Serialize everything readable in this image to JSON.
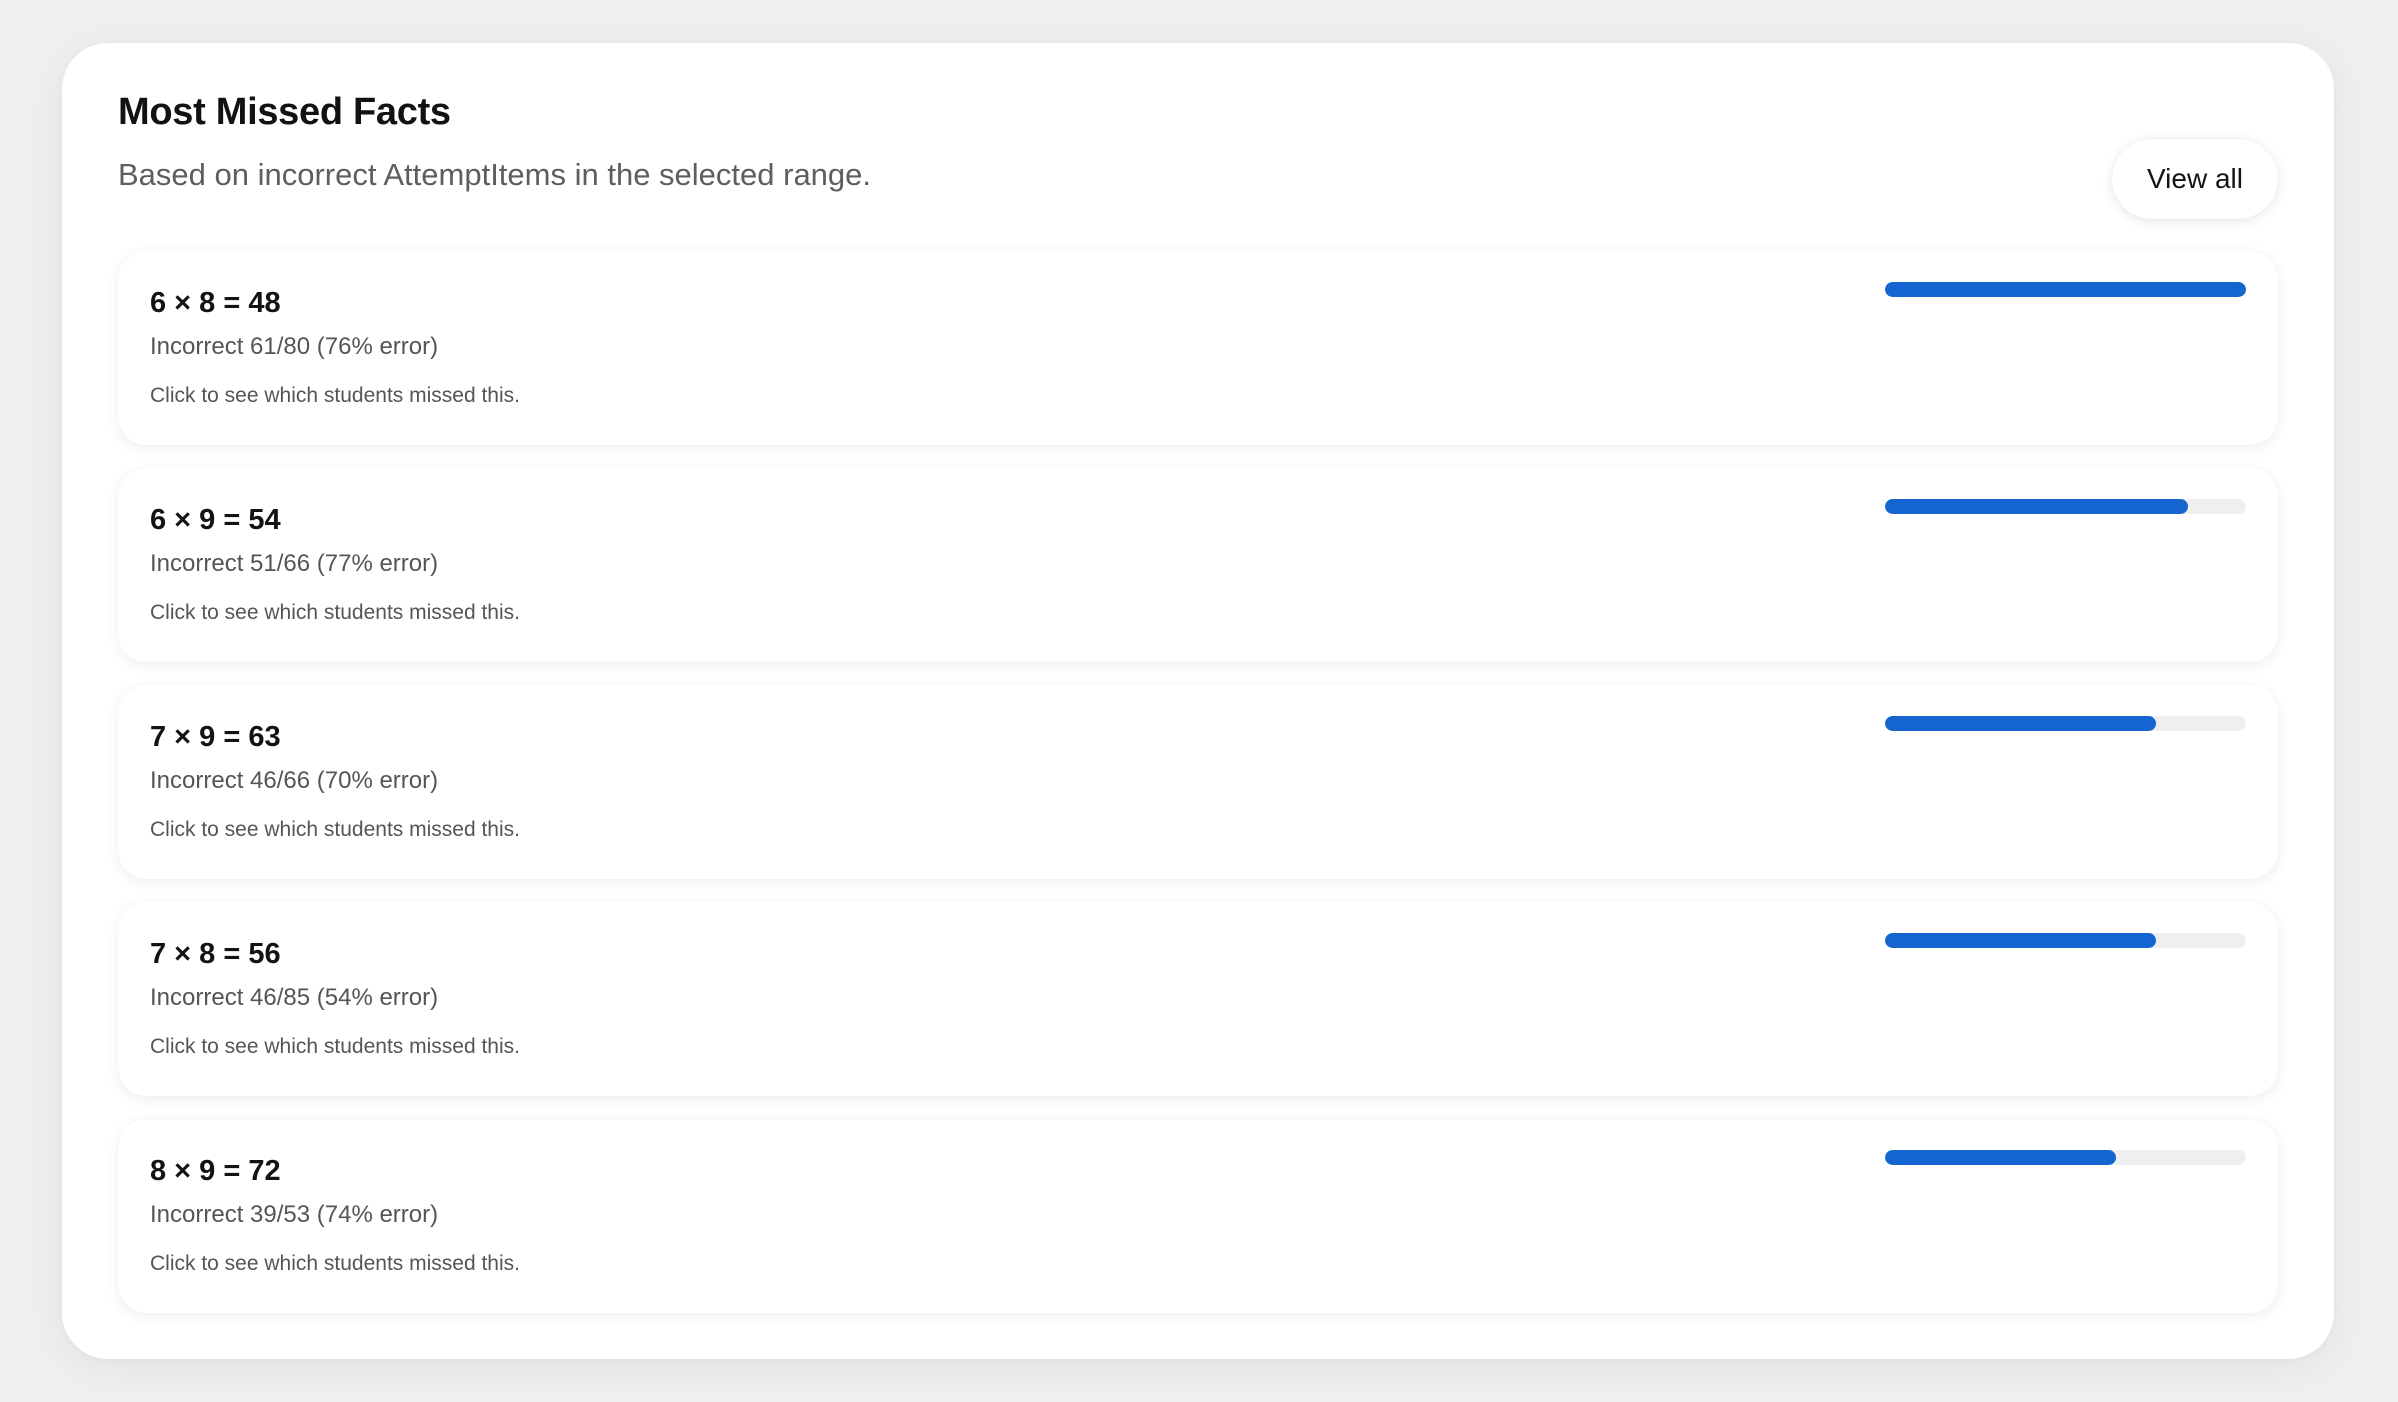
{
  "panel": {
    "title": "Most Missed Facts",
    "subtitle": "Based on incorrect AttemptItems in the selected range.",
    "view_all_label": "View all"
  },
  "facts": [
    {
      "fact": "6 × 8 = 48",
      "stat": "Incorrect 61/80 (76% error)",
      "hint": "Click to see which students missed this.",
      "bar_fraction": 1.0
    },
    {
      "fact": "6 × 9 = 54",
      "stat": "Incorrect 51/66 (77% error)",
      "hint": "Click to see which students missed this.",
      "bar_fraction": 0.84
    },
    {
      "fact": "7 × 9 = 63",
      "stat": "Incorrect 46/66 (70% error)",
      "hint": "Click to see which students missed this.",
      "bar_fraction": 0.75
    },
    {
      "fact": "7 × 8 = 56",
      "stat": "Incorrect 46/85 (54% error)",
      "hint": "Click to see which students missed this.",
      "bar_fraction": 0.75
    },
    {
      "fact": "8 × 9 = 72",
      "stat": "Incorrect 39/53 (74% error)",
      "hint": "Click to see which students missed this.",
      "bar_fraction": 0.64
    }
  ],
  "colors": {
    "accent": "#1565d0",
    "track": "#eeeff1",
    "background": "#efefef"
  }
}
